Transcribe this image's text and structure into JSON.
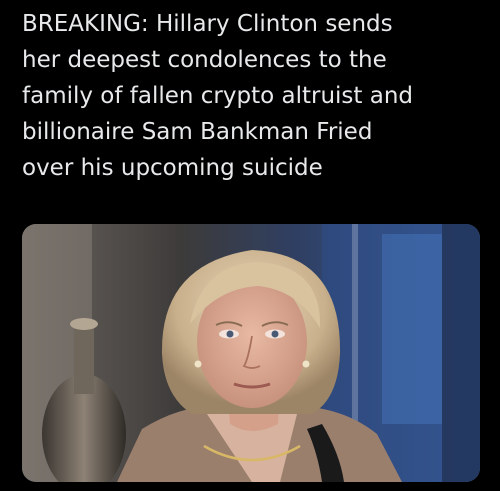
{
  "tweet": {
    "text_lines": [
      "BREAKING: Hillary Clinton sends",
      "her deepest condolences to the",
      "family of fallen crypto altruist and",
      "billionaire Sam Bankman Fried",
      "over his upcoming suicide"
    ]
  },
  "colors": {
    "background": "#000000",
    "text": "#e7e9ea"
  }
}
